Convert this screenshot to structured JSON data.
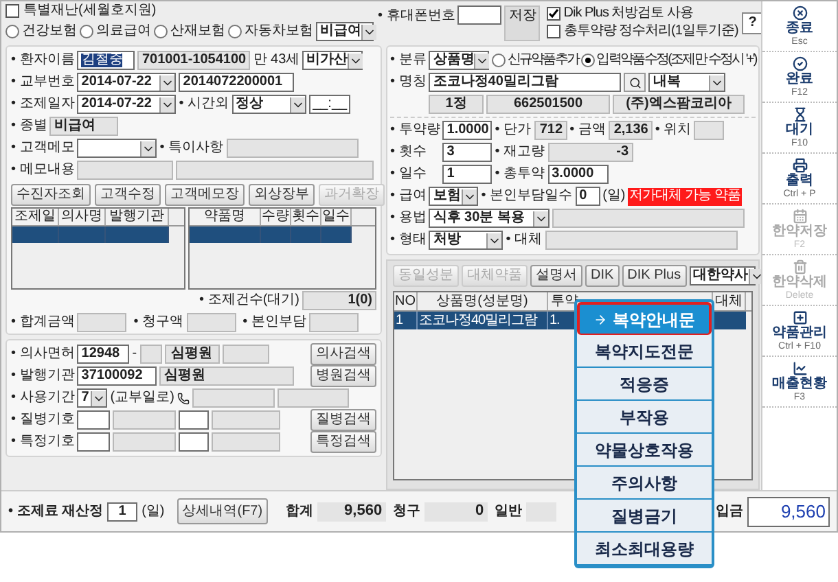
{
  "top": {
    "special_disaster": {
      "label": "특별재난(세월호지원)",
      "checked": false
    },
    "insurance": [
      {
        "label": "건강보험",
        "selected": false
      },
      {
        "label": "의료급여",
        "selected": false
      },
      {
        "label": "산재보험",
        "selected": false
      },
      {
        "label": "자동차보험",
        "selected": false
      }
    ],
    "insurance_select": "비급여",
    "phone_label": "• 휴대폰번호",
    "save_button": "저장",
    "options": [
      {
        "label": "Dik Plus 처방검토 사용",
        "checked": true
      },
      {
        "label": "총투약량 정수처리(1일투기준)",
        "checked": false
      }
    ],
    "help_button": "?"
  },
  "patient": {
    "name_label": "• 환자이름",
    "name": "김철중",
    "rrn": "701001-1054100",
    "age": "만 43세",
    "addon": "비가산",
    "issue_label": "• 교부번호",
    "issue_date": "2014-07-22",
    "issue_no": "2014072200001",
    "dispense_label": "• 조제일자",
    "dispense_date": "2014-07-22",
    "afterhours_label": "• 시간외",
    "afterhours": "정상",
    "time": "__:__",
    "type_label": "• 종별",
    "type": "비급여",
    "memo_label": "• 고객메모",
    "special_label": "• 특이사항",
    "memo_content_label": "• 메모내용"
  },
  "patient_buttons": [
    {
      "label": "수진자조회",
      "disabled": false
    },
    {
      "label": "고객수정",
      "disabled": false
    },
    {
      "label": "고객메모장",
      "disabled": false
    },
    {
      "label": "외상장부",
      "disabled": false
    },
    {
      "label": "과거확장",
      "disabled": true
    }
  ],
  "history_table": {
    "columns": [
      "조제일",
      "의사명",
      "발행기관"
    ]
  },
  "dispensed_table": {
    "columns": [
      "약품명",
      "수량",
      "횟수",
      "일수"
    ]
  },
  "count": {
    "label": "• 조제건수(대기)",
    "value": "1(0)"
  },
  "totals": [
    "• 합계금액",
    "• 청구액",
    "• 본인부담"
  ],
  "prescriber": {
    "license_label": "• 의사면허",
    "license": "12948",
    "dash": "-",
    "doctor": "심평원",
    "doctor_search": "의사검색",
    "inst_label": "• 발행기관",
    "inst_code": "37100092",
    "inst_name": "심평원",
    "inst_search": "병원검색",
    "period_label": "• 사용기간",
    "period": "7",
    "period_note": "(교부일로)",
    "disease_label": "• 질병기호",
    "disease_search": "질병검색",
    "special_label": "• 특정기호",
    "special_search": "특정검색"
  },
  "drug": {
    "class_label": "• 분류",
    "class": "상품명",
    "modes": [
      {
        "label": "신규약품추가",
        "selected": false
      },
      {
        "label": "입력약품수정(조제만 수정시 '+')",
        "selected": true
      }
    ],
    "name_label": "• 명칭",
    "name": "조코나정40밀리그람",
    "route": "내복",
    "unit": "1정",
    "code": "662501500",
    "maker": "(주)엑스팜코리아",
    "dose_label": "• 투약량",
    "dose": "1.0000",
    "price_label": "• 단가",
    "price": "712",
    "amount_label": "• 금액",
    "amount": "2,136",
    "location_label": "• 위치",
    "times_label": "• 횟수",
    "times": "3",
    "stock_label": "• 재고량",
    "stock": "-3",
    "days_label": "• 일수",
    "days": "1",
    "total_label": "• 총투약",
    "total": "3.0000",
    "benefit_label": "• 급여",
    "benefit": "보험",
    "copay_days_label": "• 본인부담일수",
    "copay_days": "0",
    "copay_unit": "(일)",
    "alert": "저가대체 가능 약품",
    "usage_label": "• 용법",
    "usage": "식후 30분 복용",
    "form_label": "• 형태",
    "form": "처방",
    "substitute_label": "• 대체"
  },
  "drug_buttons": [
    {
      "label": "동일성분",
      "disabled": true
    },
    {
      "label": "대체약품",
      "disabled": true
    },
    {
      "label": "설명서",
      "disabled": false
    },
    {
      "label": "DIK",
      "disabled": false
    },
    {
      "label": "DIK Plus",
      "disabled": false
    }
  ],
  "source_select": "대한약사",
  "rx_table": {
    "columns": [
      "NO",
      "상품명(성분명)",
      "투약",
      "대체"
    ],
    "rows": [
      {
        "cells": [
          "1",
          "조코나정40밀리그람",
          "1."
        ]
      }
    ]
  },
  "popup": {
    "items": [
      {
        "label": "복약안내문",
        "selected": true
      },
      {
        "label": "복약지도전문",
        "selected": false
      },
      {
        "label": "적응증",
        "selected": false
      },
      {
        "label": "부작용",
        "selected": false
      },
      {
        "label": "약물상호작용",
        "selected": false
      },
      {
        "label": "주의사항",
        "selected": false
      },
      {
        "label": "질병금기",
        "selected": false
      },
      {
        "label": "최소최대용량",
        "selected": false
      }
    ]
  },
  "sidebar": [
    {
      "kind": "close",
      "label": "종료",
      "key": "Esc",
      "disabled": false
    },
    {
      "kind": "done",
      "label": "완료",
      "key": "F12",
      "disabled": false
    },
    {
      "kind": "wait",
      "label": "대기",
      "key": "F10",
      "disabled": false
    },
    {
      "kind": "print",
      "label": "출력",
      "key": "Ctrl + P",
      "disabled": false
    },
    {
      "kind": "save",
      "label": "한약저장",
      "key": "F2",
      "disabled": true
    },
    {
      "kind": "delete",
      "label": "한약삭제",
      "key": "Delete",
      "disabled": true
    },
    {
      "kind": "add",
      "label": "약품관리",
      "key": "Ctrl + F10",
      "disabled": false
    },
    {
      "kind": "chart",
      "label": "매출현황",
      "key": "F3",
      "disabled": false
    }
  ],
  "bottom": {
    "recalc_label": "• 조제료 재산정",
    "recalc_days": "1",
    "recalc_unit": "(일)",
    "detail_button": "상세내역(F7)",
    "sums": [
      {
        "label": "합계",
        "value": "9,560"
      },
      {
        "label": "청구",
        "value": "0"
      },
      {
        "label": "일반"
      }
    ],
    "paid_label": "입금",
    "paid": "9,560"
  }
}
